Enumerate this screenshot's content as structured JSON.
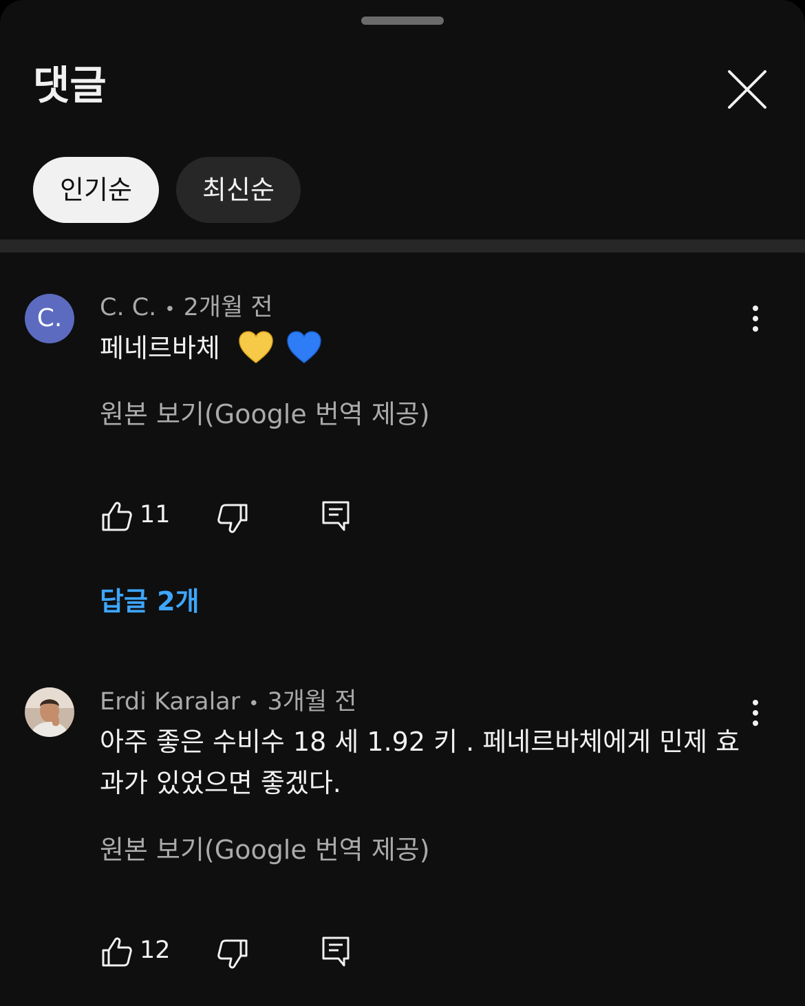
{
  "sheet": {
    "title": "댓글",
    "sort_chips": [
      "인기순",
      "최신순"
    ]
  },
  "comments": [
    {
      "avatar_letter": "C.",
      "author": "C. C.",
      "separator": "•",
      "time": "2개월 전",
      "text": "페네르바체",
      "emojis": [
        "yellow-heart",
        "blue-heart"
      ],
      "translate_label": "원본 보기(Google 번역 제공)",
      "likes": "11",
      "replies_label": "답글 2개"
    },
    {
      "avatar_letter": "",
      "author": "Erdi Karalar",
      "separator": "•",
      "time": "3개월 전",
      "text": "아주 좋은 수비수 18 세 1.92 키 . 페네르바체에게 민제 효과가 있었으면 좋겠다.",
      "translate_label": "원본 보기(Google 번역 제공)",
      "likes": "12"
    }
  ],
  "colors": {
    "background": "#0f0f0f",
    "chip_active": "#f1f1f1",
    "chip_inactive": "#272727",
    "reply_link": "#3ea6ff",
    "avatar_c": "#5c6bc0"
  }
}
